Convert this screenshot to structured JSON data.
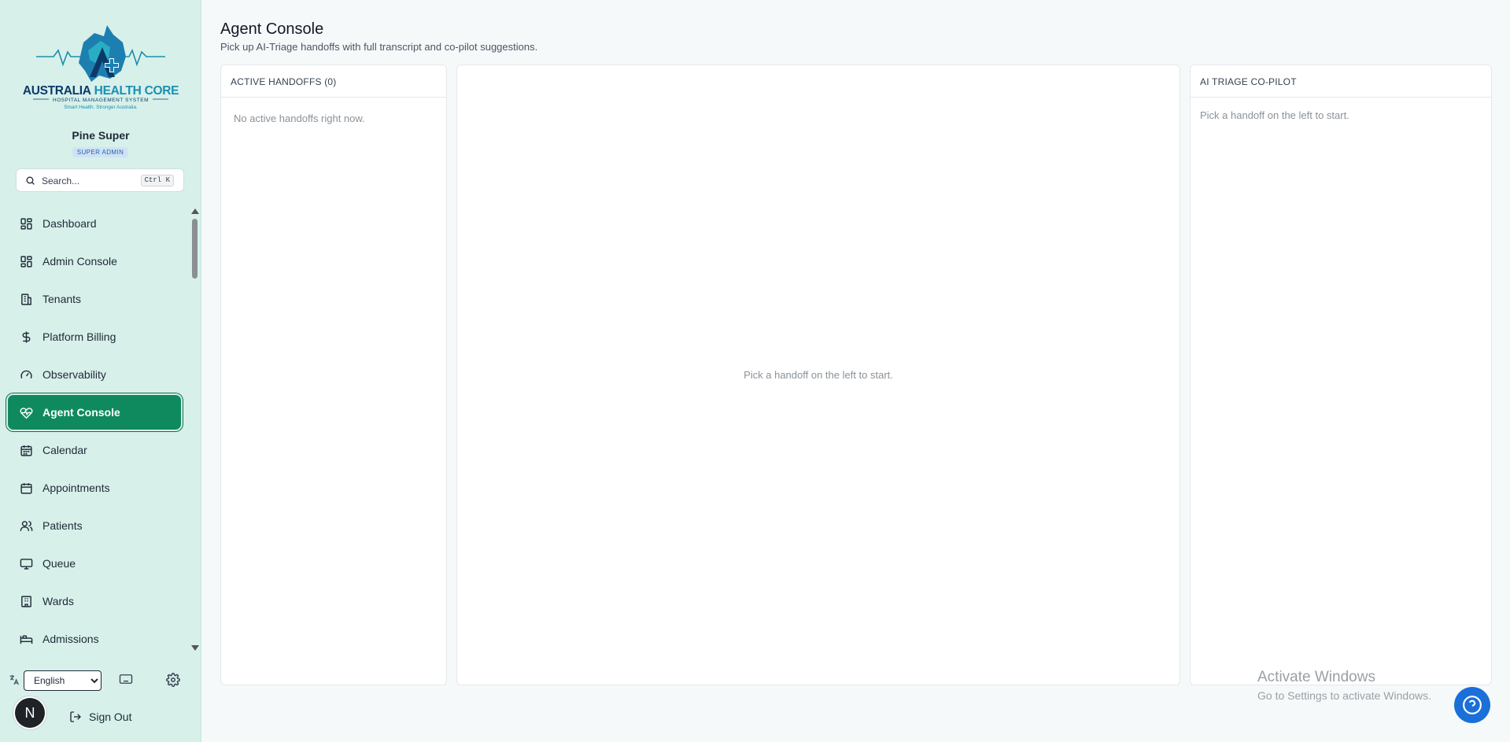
{
  "brand": {
    "name": "AUSTRALIA HEALTH CORE",
    "name_part1": "AUSTRALIA",
    "name_part2": "HEALTH CORE",
    "subtitle": "HOSPITAL MANAGEMENT SYSTEM",
    "tagline": "Smart Health. Stronger Australia.",
    "colors": {
      "primary": "#0c6f8f",
      "accent": "#20a3b8",
      "navy": "#0b3a6a"
    }
  },
  "user": {
    "name": "Pine Super",
    "role": "SUPER ADMIN",
    "avatar_letter": "N"
  },
  "search": {
    "placeholder": "Search...",
    "shortcut": "Ctrl K"
  },
  "nav": {
    "items": [
      {
        "label": "Dashboard",
        "icon": "dashboard-icon",
        "active": false
      },
      {
        "label": "Admin Console",
        "icon": "admin-console-icon",
        "active": false
      },
      {
        "label": "Tenants",
        "icon": "building-icon",
        "active": false
      },
      {
        "label": "Platform Billing",
        "icon": "dollar-icon",
        "active": false
      },
      {
        "label": "Observability",
        "icon": "gauge-icon",
        "active": false
      },
      {
        "label": "Agent Console",
        "icon": "heart-pulse-icon",
        "active": true
      },
      {
        "label": "Calendar",
        "icon": "calendar-icon",
        "active": false
      },
      {
        "label": "Appointments",
        "icon": "appointments-icon",
        "active": false
      },
      {
        "label": "Patients",
        "icon": "users-icon",
        "active": false
      },
      {
        "label": "Queue",
        "icon": "monitor-icon",
        "active": false
      },
      {
        "label": "Wards",
        "icon": "hospital-icon",
        "active": false
      },
      {
        "label": "Admissions",
        "icon": "bed-icon",
        "active": false
      }
    ]
  },
  "footer": {
    "language": "English",
    "sign_out": "Sign Out"
  },
  "page": {
    "title": "Agent Console",
    "subtitle": "Pick up AI-Triage handoffs with full transcript and co-pilot suggestions."
  },
  "panels": {
    "handoffs": {
      "title": "ACTIVE HANDOFFS (0)",
      "empty": "No active handoffs right now."
    },
    "transcript": {
      "empty": "Pick a handoff on the left to start."
    },
    "copilot": {
      "title": "AI TRIAGE CO-PILOT",
      "empty": "Pick a handoff on the left to start."
    }
  },
  "watermark": {
    "line1": "Activate Windows",
    "line2": "Go to Settings to activate Windows."
  },
  "accent": "#0f8a5f"
}
